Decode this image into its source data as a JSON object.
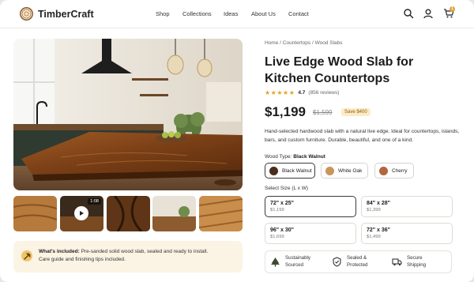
{
  "brand": {
    "name": "TimberCraft"
  },
  "nav": [
    "Shop",
    "Collections",
    "Ideas",
    "About Us",
    "Contact"
  ],
  "header_icons": {
    "search": "search-icon",
    "account": "user-icon",
    "cart": "cart-icon",
    "cart_count": "1"
  },
  "gallery": {
    "thumbnails": [
      {
        "name": "wood-grain-thumb"
      },
      {
        "name": "video-thumb",
        "duration": "1:08"
      },
      {
        "name": "slab-closeup-thumb"
      },
      {
        "name": "kitchen-thumb"
      },
      {
        "name": "plank-stack-thumb"
      }
    ],
    "included": {
      "title": "What's included:",
      "text": "Pre-sanded solid wood slab, sealed and ready to install.",
      "text2": "Care guide and finishing tips included."
    }
  },
  "product": {
    "breadcrumb": "Home / Countertops / Wood Slabs",
    "title": "Live Edge Wood Slab for Kitchen Countertops",
    "rating": "4.7",
    "reviews": "(856 reviews)",
    "stars": "★★★★★",
    "price": "$1,199",
    "old_price": "$1,599",
    "save": "Save $400",
    "description": "Hand-selected hardwood slab with a natural live edge. Ideal for countertops, islands, bars, and custom furniture. Durable, beautiful, and one of a kind.",
    "wood_type_label": "Wood Type:",
    "wood_type_value": "Black Walnut",
    "wood_types": [
      {
        "label": "Black Walnut",
        "color": "#4a2e1c",
        "selected": true
      },
      {
        "label": "White Oak",
        "color": "#c8965c",
        "selected": false
      },
      {
        "label": "Cherry",
        "color": "#b0683c",
        "selected": false
      }
    ],
    "size_label": "Select Size (L x W)",
    "sizes": [
      {
        "size": "72\" x 25\"",
        "price": "$1,199",
        "selected": true
      },
      {
        "size": "84\" x 28\"",
        "price": "$1,399",
        "selected": false
      },
      {
        "size": "96\" x 30\"",
        "price": "$1,699",
        "selected": false
      },
      {
        "size": "72\" x 36\"",
        "price": "$1,499",
        "selected": false
      }
    ],
    "features": [
      {
        "line1": "Sustainably",
        "line2": "Sourced",
        "icon": "tree-icon"
      },
      {
        "line1": "Sealed &",
        "line2": "Protected",
        "icon": "shield-check-icon"
      },
      {
        "line1": "Secure",
        "line2": "Shipping",
        "icon": "truck-icon"
      }
    ]
  },
  "colors": {
    "accent": "#e0a33a",
    "star": "#e6a31f",
    "save_bg": "#fbecc6"
  }
}
